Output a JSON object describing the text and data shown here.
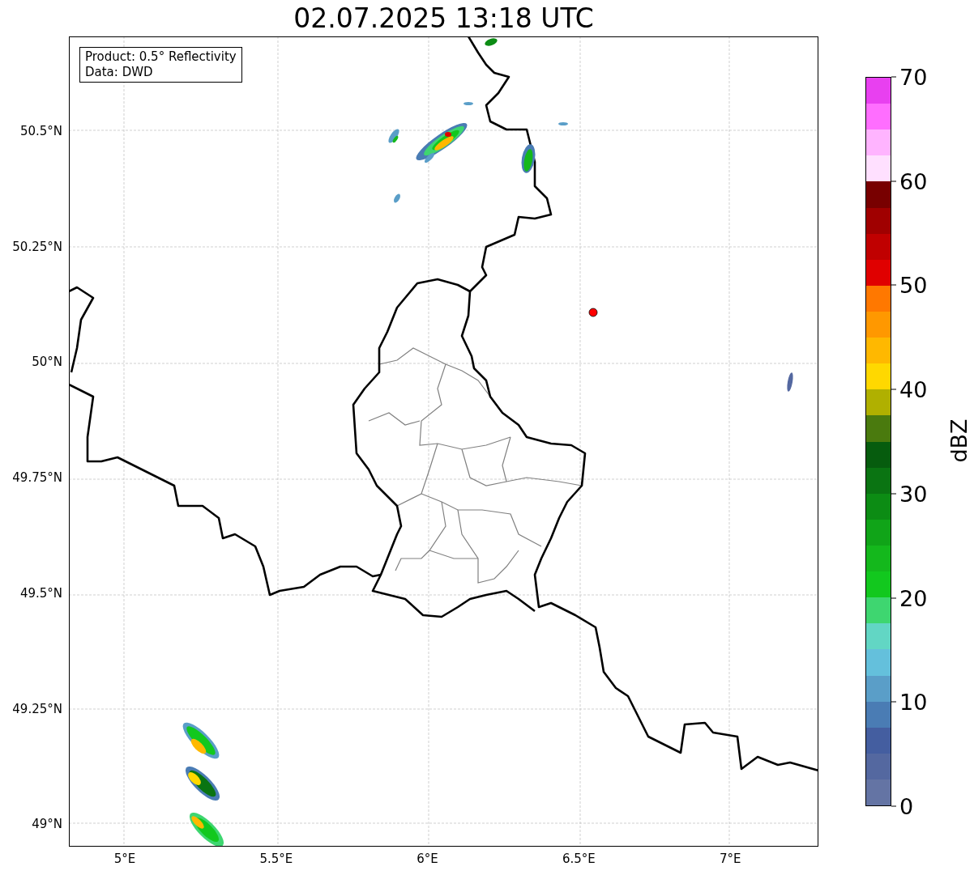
{
  "title": "02.07.2025 13:18 UTC",
  "legend_box": {
    "lines": [
      "Product: 0.5° Reflectivity",
      "Data: DWD"
    ]
  },
  "map": {
    "x_ticks": [
      "5°E",
      "5.5°E",
      "6°E",
      "6.5°E",
      "7°E"
    ],
    "y_ticks": [
      "50.5°N",
      "50.25°N",
      "50°N",
      "49.75°N",
      "49.5°N",
      "49.25°N",
      "49°N"
    ]
  },
  "colorbar": {
    "label": "dBZ",
    "ticks": [
      "70",
      "60",
      "50",
      "40",
      "30",
      "20",
      "10",
      "0"
    ],
    "bins": [
      {
        "color": "#e840f0"
      },
      {
        "color": "#ff6eff"
      },
      {
        "color": "#ffb4ff"
      },
      {
        "color": "#ffe0ff"
      },
      {
        "color": "#780000"
      },
      {
        "color": "#a00000"
      },
      {
        "color": "#c00000"
      },
      {
        "color": "#e00000"
      },
      {
        "color": "#ff7800"
      },
      {
        "color": "#ff9800"
      },
      {
        "color": "#ffb800"
      },
      {
        "color": "#ffd800"
      },
      {
        "color": "#b0b000"
      },
      {
        "color": "#4a7a0e"
      },
      {
        "color": "#065c0e"
      },
      {
        "color": "#0a7412"
      },
      {
        "color": "#0c8c14"
      },
      {
        "color": "#10a418"
      },
      {
        "color": "#14b81c"
      },
      {
        "color": "#12c81e"
      },
      {
        "color": "#3ed670"
      },
      {
        "color": "#62d6c4"
      },
      {
        "color": "#64c0dc"
      },
      {
        "color": "#5a9ec8"
      },
      {
        "color": "#4a7cb4"
      },
      {
        "color": "#445ea0"
      },
      {
        "color": "#5468a0"
      },
      {
        "color": "#6474a4"
      }
    ]
  }
}
